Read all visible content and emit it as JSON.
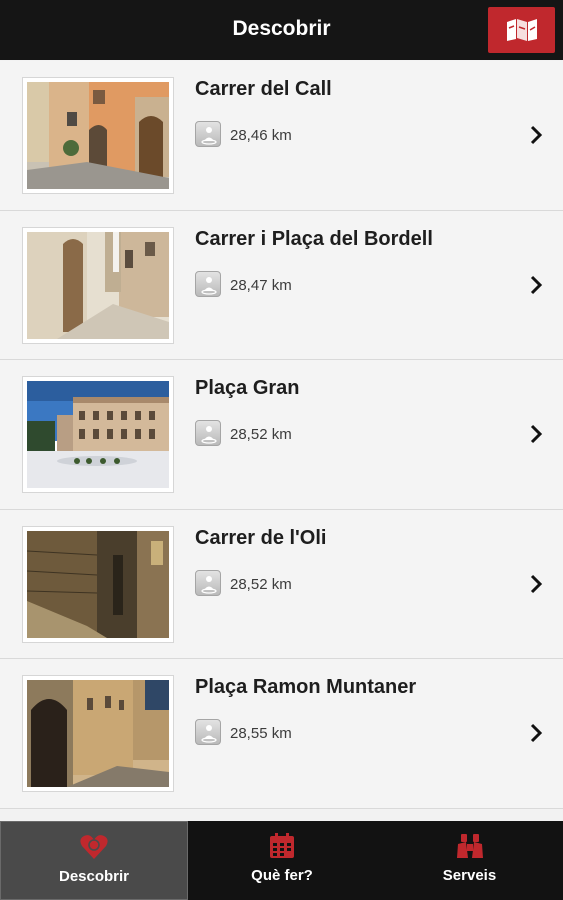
{
  "header": {
    "title": "Descobrir",
    "map_icon": "map-icon"
  },
  "places": [
    {
      "name": "Carrer del Call",
      "distance": "28,46 km"
    },
    {
      "name": "Carrer i Plaça del Bordell",
      "distance": "28,47 km"
    },
    {
      "name": "Plaça Gran",
      "distance": "28,52 km"
    },
    {
      "name": "Carrer de l'Oli",
      "distance": "28,52 km"
    },
    {
      "name": "Plaça Ramon Muntaner",
      "distance": "28,55 km"
    }
  ],
  "tabs": [
    {
      "label": "Descobrir",
      "icon": "heart-icon",
      "active": true
    },
    {
      "label": "Què fer?",
      "icon": "calendar-icon",
      "active": false
    },
    {
      "label": "Serveis",
      "icon": "binoculars-icon",
      "active": false
    }
  ],
  "colors": {
    "accent": "#c0282d",
    "bar": "#151515",
    "list_bg": "#f4f4f4"
  }
}
